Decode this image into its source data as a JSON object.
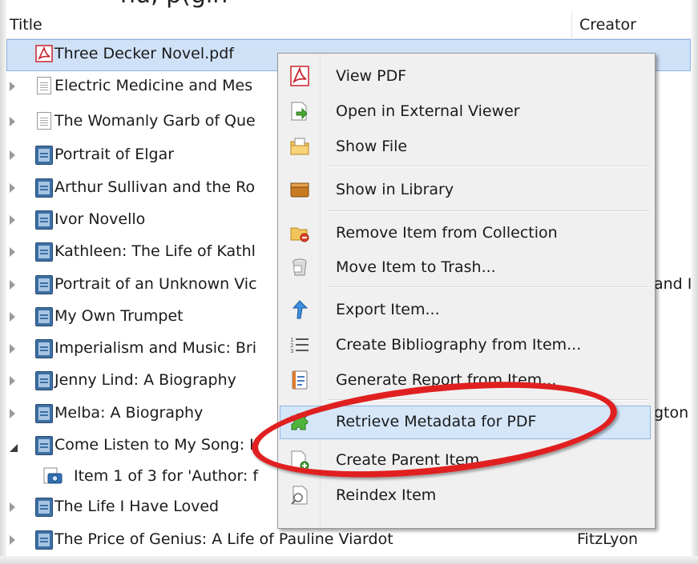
{
  "header": {
    "title_col": "Title",
    "creator_col": "Creator",
    "clipped_heading": "nu, p(gin"
  },
  "rows": [
    {
      "title": "Three Decker Novel.pdf",
      "creator": "",
      "icon": "pdf-icon",
      "twisty": "none",
      "selected": true
    },
    {
      "title": "Electric Medicine and Mes",
      "creator": "",
      "icon": "document-icon",
      "twisty": "closed"
    },
    {
      "title": "The Womanly Garb of Que",
      "creator": "",
      "icon": "document-icon",
      "twisty": "closed"
    },
    {
      "title": "Portrait of Elgar",
      "creator": "",
      "icon": "book-icon",
      "twisty": "closed"
    },
    {
      "title": "Arthur Sullivan and the Ro",
      "creator": "",
      "icon": "book-icon",
      "twisty": "closed"
    },
    {
      "title": "Ivor Novello",
      "creator": "",
      "icon": "book-icon",
      "twisty": "closed"
    },
    {
      "title": "Kathleen: The Life of Kathl",
      "creator": "",
      "icon": "book-icon",
      "twisty": "closed"
    },
    {
      "title": "Portrait of an Unknown Vic",
      "creator": "and I",
      "icon": "book-icon",
      "twisty": "closed"
    },
    {
      "title": "My Own Trumpet",
      "creator": "",
      "icon": "book-icon",
      "twisty": "closed"
    },
    {
      "title": "Imperialism and Music: Bri",
      "creator": "",
      "icon": "book-icon",
      "twisty": "closed"
    },
    {
      "title": "Jenny Lind: A Biography",
      "creator": "",
      "icon": "book-icon",
      "twisty": "closed"
    },
    {
      "title": "Melba: A Biography",
      "creator": "gton",
      "icon": "book-icon",
      "twisty": "closed"
    },
    {
      "title": "Come Listen to My Song: I",
      "creator": "",
      "icon": "book-icon",
      "twisty": "open"
    },
    {
      "title": "Item 1 of 3 for 'Author: f",
      "creator": "",
      "icon": "snapshot-icon",
      "twisty": "none",
      "child": true
    },
    {
      "title": "The Life I Have Loved",
      "creator": "",
      "icon": "book-icon",
      "twisty": "closed"
    },
    {
      "title": "The Price of Genius: A Life of Pauline Viardot",
      "creator": "FitzLyon",
      "icon": "book-icon",
      "twisty": "closed"
    }
  ],
  "menu": {
    "items": [
      {
        "label": "View PDF",
        "icon": "pdf-icon"
      },
      {
        "label": "Open in External Viewer",
        "icon": "open-external-icon"
      },
      {
        "label": "Show File",
        "icon": "folder-icon"
      },
      {
        "label": "Show in Library",
        "icon": "library-box-icon"
      },
      {
        "label": "Remove Item from Collection",
        "icon": "folder-remove-icon"
      },
      {
        "label": "Move Item to Trash...",
        "icon": "trash-icon"
      },
      {
        "label": "Export Item...",
        "icon": "export-arrow-icon"
      },
      {
        "label": "Create Bibliography from Item...",
        "icon": "list-icon"
      },
      {
        "label": "Generate Report from Item...",
        "icon": "report-icon"
      },
      {
        "label": "Retrieve Metadata for PDF",
        "icon": "puzzle-icon",
        "highlighted": true
      },
      {
        "label": "Create Parent Item",
        "icon": "add-document-icon"
      },
      {
        "label": "Reindex Item",
        "icon": "reindex-icon"
      }
    ]
  },
  "colors": {
    "selection": "#cfe1f7",
    "menu_hover": "#d5e6f9",
    "annotation_ring": "#e02020"
  }
}
